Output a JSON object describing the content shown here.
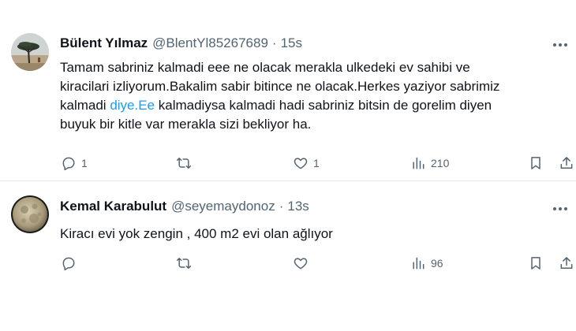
{
  "tweets": [
    {
      "name": "Bülent Yılmaz",
      "handle": "@BlentYl85267689",
      "separator": "·",
      "time": "15s",
      "lines": [
        "Tamam sabriniz kalmadi eee ne olacak merakla ulkedeki ev sahibi ve",
        "kiracilari izliyorum.Bakalim sabir bitince ne olacak.Herkes yaziyor sabrimiz",
        "kalmadi ",
        "diye.Ee",
        " kalmadiysa kalmadi hadi sabriniz  bitsin de gorelim diyen",
        "buyuk bir kitle var merakla sizi bekliyor ha."
      ],
      "replies": "1",
      "retweets": "",
      "likes": "1",
      "views": "210",
      "icons": [
        "reply-icon",
        "retweet-icon",
        "like-icon",
        "views-icon",
        "bookmark-icon",
        "share-icon",
        "more-icon"
      ]
    },
    {
      "name": "Kemal Karabulut",
      "handle": "@seyemaydonoz",
      "separator": "·",
      "time": "13s",
      "lines": [
        "Kiracı evi yok zengin , 400 m2 evi olan ağlıyor"
      ],
      "replies": "",
      "retweets": "",
      "likes": "",
      "views": "96",
      "icons": [
        "reply-icon",
        "retweet-icon",
        "like-icon",
        "views-icon",
        "bookmark-icon",
        "share-icon",
        "more-icon"
      ]
    }
  ],
  "colors": {
    "text": "#0f1419",
    "secondary": "#536471",
    "link": "#1d9bf0",
    "divider": "#e6e9ec"
  }
}
